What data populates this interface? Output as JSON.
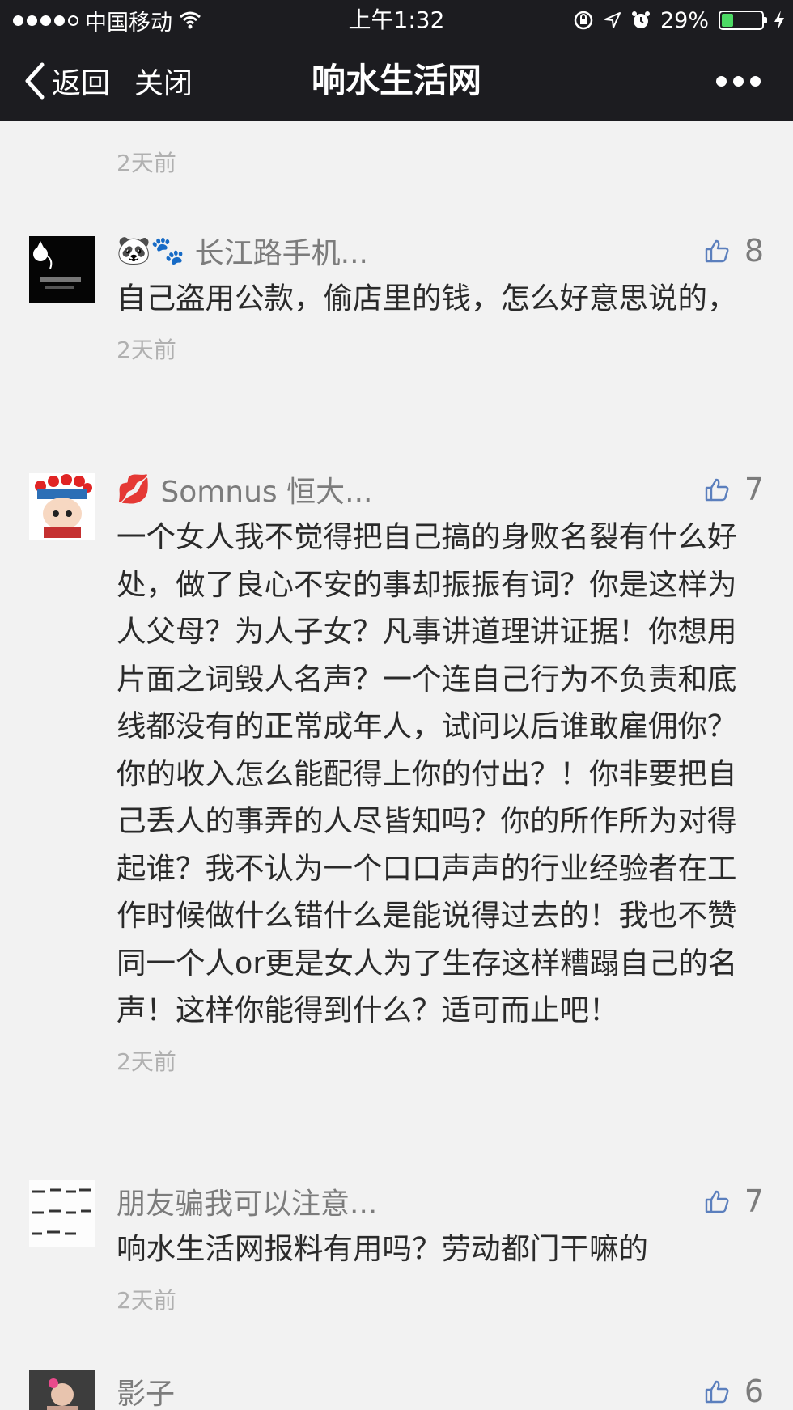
{
  "status_bar": {
    "carrier": "中国移动",
    "time": "上午1:32",
    "battery": "29%",
    "battery_level": 0.29,
    "icons": [
      "signal-dots-icon",
      "wifi-icon",
      "rotation-lock-icon",
      "location-icon",
      "alarm-icon",
      "battery-icon",
      "charging-icon"
    ]
  },
  "nav": {
    "back_label": "返回",
    "close_label": "关闭",
    "title": "响水生活网",
    "more_icon": "more-dots-icon"
  },
  "comments": [
    {
      "time": "2天前"
    },
    {
      "nickname": "长江路手机...",
      "emoji_prefix": "🐼🐾",
      "likes": "8",
      "text": "自己盗用公款，偷店里的钱，怎么好意思说的，",
      "time": "2天前"
    },
    {
      "nickname": "Somnus 恒大...",
      "emoji_prefix": "💋",
      "likes": "7",
      "text": "一个女人我不觉得把自己搞的身败名裂有什么好处，做了良心不安的事却振振有词？你是这样为人父母？为人子女？凡事讲道理讲证据！你想用片面之词毁人名声？一个连自己行为不负责和底线都没有的正常成年人，试问以后谁敢雇佣你？你的收入怎么能配得上你的付出？！你非要把自己丢人的事弄的人尽皆知吗？你的所作所为对得起谁？我不认为一个口口声声的行业经验者在工作时候做什么错什么是能说得过去的！我也不赞同一个人or更是女人为了生存这样糟蹋自己的名声！这样你能得到什么？适可而止吧！",
      "time": "2天前"
    },
    {
      "nickname": "朋友骗我可以注意...",
      "likes": "7",
      "text": "响水生活网报料有用吗？劳动都门干嘛的",
      "time": "2天前"
    },
    {
      "nickname": "影子",
      "likes": "6"
    }
  ]
}
